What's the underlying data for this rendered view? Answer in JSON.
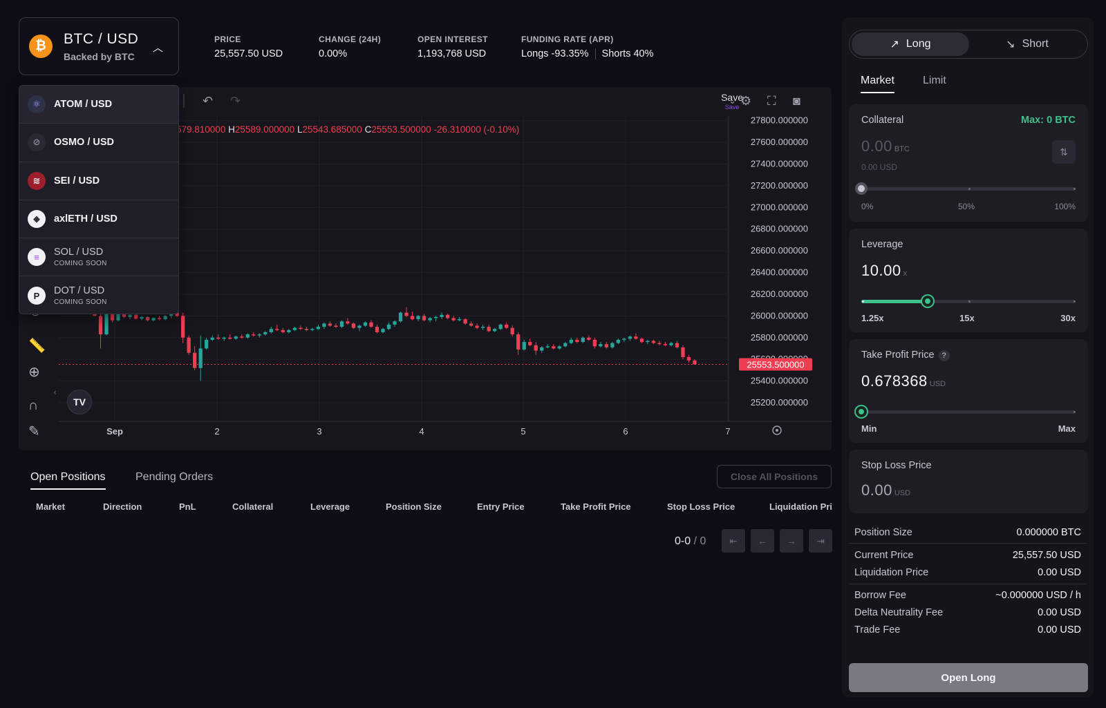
{
  "market": {
    "pair": "BTC / USD",
    "backed_by": "Backed by BTC",
    "coin_symbol": "₿",
    "coin_color": "#f7931a"
  },
  "stats": [
    {
      "label": "PRICE",
      "value": "25,557.50 USD"
    },
    {
      "label": "CHANGE (24H)",
      "value": "0.00%"
    },
    {
      "label": "OPEN INTEREST",
      "value": "1,193,768 USD"
    },
    {
      "label": "FUNDING RATE (APR)",
      "longs": "Longs -93.35%",
      "shorts": "Shorts 40%"
    }
  ],
  "dropdown": [
    {
      "label": "ATOM / USD",
      "soon": "",
      "icon": "atom-icon",
      "color": "#2e3148"
    },
    {
      "label": "OSMO / USD",
      "soon": "",
      "icon": "osmo-icon",
      "color": "#2a2833"
    },
    {
      "label": "SEI / USD",
      "soon": "",
      "icon": "sei-icon",
      "color": "#9e1f2c"
    },
    {
      "label": "axlETH / USD",
      "soon": "",
      "icon": "eth-icon",
      "color": "#f2f1f6"
    },
    {
      "label": "SOL / USD",
      "soon": "COMING SOON",
      "icon": "sol-icon",
      "color": "#f2f1f6"
    },
    {
      "label": "DOT / USD",
      "soon": "COMING SOON",
      "icon": "dot-icon",
      "color": "#f2f1f6"
    }
  ],
  "chart_toolbar": {
    "save_label": "Save",
    "save_sub": "Save"
  },
  "ohlc": {
    "open": "579.810000",
    "h_key": "H",
    "high": "25589.000000",
    "l_key": "L",
    "low": "25543.685000",
    "c_key": "C",
    "close": "25553.500000",
    "change": "-26.310000 (-0.10%)"
  },
  "chart_data": {
    "type": "candlestick",
    "x_ticks": [
      "Sep",
      "2",
      "3",
      "4",
      "5",
      "6",
      "7"
    ],
    "y_ticks": [
      "27800.000000",
      "27600.000000",
      "27400.000000",
      "27200.000000",
      "27000.000000",
      "26800.000000",
      "26600.000000",
      "26400.000000",
      "26200.000000",
      "26000.000000",
      "25800.000000",
      "25600.000000",
      "25400.000000",
      "25200.000000"
    ],
    "ylim": [
      25130,
      27830
    ],
    "last_price_label": "25553.500000",
    "last_price": 25553.5,
    "up_color": "#26a69a",
    "down_color": "#ef3e52",
    "candles": [
      [
        26040,
        26080,
        26010,
        26000
      ],
      [
        26000,
        26060,
        25700,
        25830
      ],
      [
        25830,
        26050,
        25820,
        26020
      ],
      [
        26020,
        26060,
        25940,
        25960
      ],
      [
        25960,
        26030,
        25950,
        26020
      ],
      [
        26020,
        26050,
        25980,
        25990
      ],
      [
        25990,
        26030,
        25970,
        26010
      ],
      [
        26010,
        26020,
        25970,
        25975
      ],
      [
        25975,
        26000,
        25960,
        25990
      ],
      [
        25990,
        26000,
        25950,
        25960
      ],
      [
        25960,
        25990,
        25950,
        25980
      ],
      [
        25980,
        26000,
        25960,
        25970
      ],
      [
        25970,
        26010,
        25960,
        26000
      ],
      [
        26000,
        26040,
        25980,
        26030
      ],
      [
        26030,
        26060,
        25990,
        26000
      ],
      [
        26000,
        26030,
        25750,
        25800
      ],
      [
        25800,
        25820,
        25640,
        25660
      ],
      [
        25660,
        25720,
        25500,
        25520
      ],
      [
        25520,
        25820,
        25400,
        25700
      ],
      [
        25700,
        25800,
        25690,
        25780
      ],
      [
        25780,
        25820,
        25770,
        25800
      ],
      [
        25800,
        25830,
        25780,
        25790
      ],
      [
        25790,
        25810,
        25770,
        25800
      ],
      [
        25800,
        25830,
        25780,
        25790
      ],
      [
        25790,
        25820,
        25780,
        25810
      ],
      [
        25810,
        25830,
        25790,
        25800
      ],
      [
        25800,
        25840,
        25790,
        25830
      ],
      [
        25830,
        25850,
        25810,
        25820
      ],
      [
        25820,
        25840,
        25800,
        25830
      ],
      [
        25830,
        25860,
        25820,
        25850
      ],
      [
        25850,
        25900,
        25840,
        25880
      ],
      [
        25880,
        25920,
        25860,
        25870
      ],
      [
        25870,
        25890,
        25840,
        25850
      ],
      [
        25850,
        25880,
        25840,
        25870
      ],
      [
        25870,
        25900,
        25860,
        25890
      ],
      [
        25890,
        25910,
        25870,
        25880
      ],
      [
        25880,
        25900,
        25860,
        25870
      ],
      [
        25870,
        25890,
        25860,
        25880
      ],
      [
        25880,
        25920,
        25870,
        25900
      ],
      [
        25900,
        25940,
        25880,
        25930
      ],
      [
        25930,
        25950,
        25900,
        25910
      ],
      [
        25910,
        25930,
        25890,
        25900
      ],
      [
        25900,
        25960,
        25890,
        25950
      ],
      [
        25950,
        25980,
        25920,
        25930
      ],
      [
        25930,
        25940,
        25880,
        25890
      ],
      [
        25890,
        25920,
        25860,
        25910
      ],
      [
        25910,
        25950,
        25900,
        25940
      ],
      [
        25940,
        25960,
        25890,
        25900
      ],
      [
        25900,
        25920,
        25840,
        25850
      ],
      [
        25850,
        25890,
        25840,
        25880
      ],
      [
        25880,
        25940,
        25870,
        25920
      ],
      [
        25920,
        25960,
        25900,
        25950
      ],
      [
        25950,
        26040,
        25940,
        26030
      ],
      [
        26030,
        26080,
        25990,
        26000
      ],
      [
        26000,
        26040,
        25960,
        25970
      ],
      [
        25970,
        26010,
        25950,
        26000
      ],
      [
        26000,
        26020,
        25950,
        25960
      ],
      [
        25960,
        25990,
        25940,
        25980
      ],
      [
        25980,
        26000,
        25950,
        25990
      ],
      [
        25990,
        26030,
        25970,
        26010
      ],
      [
        26010,
        26020,
        25970,
        25980
      ],
      [
        25980,
        26000,
        25950,
        25960
      ],
      [
        25960,
        25990,
        25950,
        25970
      ],
      [
        25970,
        25980,
        25920,
        25930
      ],
      [
        25930,
        25950,
        25900,
        25910
      ],
      [
        25910,
        25930,
        25880,
        25890
      ],
      [
        25890,
        25920,
        25870,
        25900
      ],
      [
        25900,
        25920,
        25850,
        25860
      ],
      [
        25860,
        25890,
        25850,
        25880
      ],
      [
        25880,
        25930,
        25870,
        25920
      ],
      [
        25920,
        25940,
        25880,
        25890
      ],
      [
        25890,
        25910,
        25810,
        25830
      ],
      [
        25830,
        25850,
        25640,
        25690
      ],
      [
        25690,
        25780,
        25680,
        25760
      ],
      [
        25760,
        25790,
        25720,
        25730
      ],
      [
        25730,
        25760,
        25640,
        25680
      ],
      [
        25680,
        25720,
        25660,
        25710
      ],
      [
        25710,
        25740,
        25700,
        25720
      ],
      [
        25720,
        25740,
        25690,
        25700
      ],
      [
        25700,
        25730,
        25690,
        25720
      ],
      [
        25720,
        25760,
        25710,
        25750
      ],
      [
        25750,
        25800,
        25740,
        25780
      ],
      [
        25780,
        25800,
        25750,
        25760
      ],
      [
        25760,
        25810,
        25750,
        25800
      ],
      [
        25800,
        25820,
        25770,
        25780
      ],
      [
        25780,
        25800,
        25700,
        25720
      ],
      [
        25720,
        25760,
        25710,
        25740
      ],
      [
        25740,
        25760,
        25700,
        25710
      ],
      [
        25710,
        25760,
        25700,
        25750
      ],
      [
        25750,
        25790,
        25740,
        25780
      ],
      [
        25780,
        25800,
        25760,
        25790
      ],
      [
        25790,
        25820,
        25770,
        25810
      ],
      [
        25810,
        25840,
        25780,
        25790
      ],
      [
        25790,
        25800,
        25750,
        25760
      ],
      [
        25760,
        25780,
        25740,
        25770
      ],
      [
        25770,
        25780,
        25740,
        25750
      ],
      [
        25750,
        25770,
        25730,
        25740
      ],
      [
        25740,
        25760,
        25720,
        25730
      ],
      [
        25730,
        25760,
        25720,
        25750
      ],
      [
        25750,
        25770,
        25700,
        25710
      ],
      [
        25710,
        25730,
        25600,
        25620
      ],
      [
        25620,
        25640,
        25570,
        25590
      ],
      [
        25590,
        25600,
        25550,
        25553.5
      ]
    ]
  },
  "positions": {
    "tabs": [
      "Open Positions",
      "Pending Orders"
    ],
    "close_all": "Close All Positions",
    "columns": [
      "Market",
      "Direction",
      "PnL",
      "Collateral",
      "Leverage",
      "Position Size",
      "Entry Price",
      "Take Profit Price",
      "Stop Loss Price",
      "Liquidation Price"
    ],
    "pager_range": "0-0",
    "pager_total": "/ 0"
  },
  "order": {
    "long": "Long",
    "short": "Short",
    "tabs": [
      "Market",
      "Limit"
    ],
    "collateral": {
      "title": "Collateral",
      "max": "Max: 0 BTC",
      "value": "0.00",
      "unit": "BTC",
      "usd": "0.00 USD",
      "ticks": [
        "0%",
        "50%",
        "100%"
      ],
      "percent": 0
    },
    "leverage": {
      "title": "Leverage",
      "value": "10.00",
      "unit": "x",
      "ticks": [
        "1.25x",
        "15x",
        "30x"
      ],
      "fill_fraction": 0.31
    },
    "take_profit": {
      "title": "Take Profit Price",
      "help": "?",
      "value": "0.678368",
      "unit": "USD",
      "ticks": [
        "Min",
        "Max"
      ],
      "fraction": 0
    },
    "stop_loss": {
      "title": "Stop Loss Price",
      "value": "0.00",
      "unit": "USD"
    },
    "info": [
      {
        "label": "Position Size",
        "value": "0.000000 BTC"
      },
      {
        "label": "Current Price",
        "value": "25,557.50 USD"
      },
      {
        "label": "Liquidation Price",
        "value": "0.00 USD"
      },
      {
        "label": "Borrow Fee",
        "value": "~0.000000 USD / h"
      },
      {
        "label": "Delta Neutrality Fee",
        "value": "0.00 USD"
      },
      {
        "label": "Trade Fee",
        "value": "0.00 USD"
      }
    ],
    "submit": "Open Long"
  }
}
